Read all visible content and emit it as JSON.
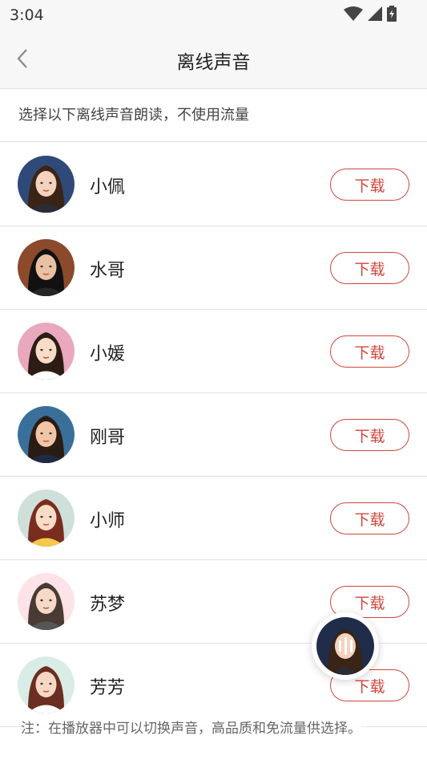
{
  "status": {
    "time": "3:04"
  },
  "header": {
    "title": "离线声音"
  },
  "subtitle": "选择以下离线声音朗读，不使用流量",
  "voices": [
    {
      "name": "小佩",
      "button": "下载",
      "bg": "#2f4a78",
      "hair": "#3a2416",
      "skin": "#f3d3bd",
      "cloth": "#2b2b36"
    },
    {
      "name": "水哥",
      "button": "下载",
      "bg": "#8b4a2c",
      "hair": "#111111",
      "skin": "#eac0a3",
      "cloth": "#262626"
    },
    {
      "name": "小媛",
      "button": "下载",
      "bg": "#e9a8bd",
      "hair": "#2c1c14",
      "skin": "#f7dcc8",
      "cloth": "#ffffff"
    },
    {
      "name": "刚哥",
      "button": "下载",
      "bg": "#3a6f9a",
      "hair": "#2a1c14",
      "skin": "#f0c6a6",
      "cloth": "#1f2a44"
    },
    {
      "name": "小师",
      "button": "下载",
      "bg": "#cfe0da",
      "hair": "#7a2d1f",
      "skin": "#f8dcc8",
      "cloth": "#f4c84a"
    },
    {
      "name": "苏梦",
      "button": "下载",
      "bg": "#fde3e7",
      "hair": "#4a3a34",
      "skin": "#f7d9c8",
      "cloth": "#555555"
    },
    {
      "name": "芳芳",
      "button": "下载",
      "bg": "#d9ece6",
      "hair": "#6a2e22",
      "skin": "#f7d7c3",
      "cloth": "#ffffff"
    }
  ],
  "footer_note": "注：在播放器中可以切换声音，高品质和免流量供选择。",
  "colors": {
    "accent": "#d0463b"
  }
}
